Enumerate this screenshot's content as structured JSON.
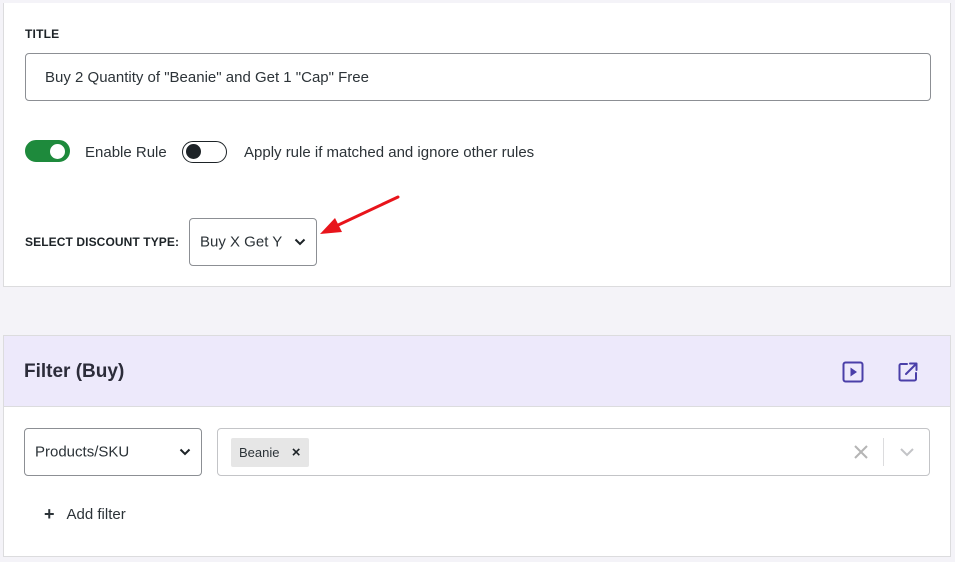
{
  "rule": {
    "title_label": "TITLE",
    "title_value": "Buy 2 Quantity of \"Beanie\" and Get 1 \"Cap\" Free",
    "enable_rule_label": "Enable Rule",
    "enable_rule_on": true,
    "exclusive_label": "Apply rule if matched and ignore other rules",
    "exclusive_on": false,
    "discount_type_label": "SELECT DISCOUNT TYPE:",
    "discount_type_value": "Buy X Get Y"
  },
  "filter": {
    "title": "Filter (Buy)",
    "type_value": "Products/SKU",
    "selected_tags": [
      "Beanie"
    ],
    "add_filter_label": "Add filter"
  },
  "colors": {
    "toggle_on": "#1e8a3c",
    "filter_header_bg": "#ede9fb",
    "icon_accent": "#4a3fa8",
    "annotation_arrow": "#e8141b"
  },
  "icons": {
    "play": "play-square-icon",
    "external": "external-link-icon",
    "arrow": "red-arrow-annotation"
  }
}
